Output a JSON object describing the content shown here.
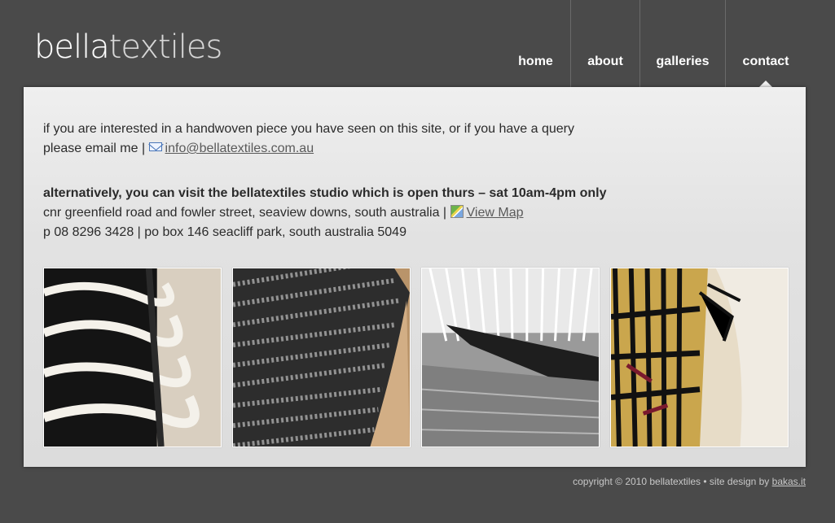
{
  "logo": {
    "part1": "bella",
    "part2": "textiles"
  },
  "nav": {
    "items": [
      {
        "label": "home"
      },
      {
        "label": "about"
      },
      {
        "label": "galleries"
      },
      {
        "label": "contact"
      }
    ],
    "active": "contact"
  },
  "content": {
    "line1": "if you are interested in a handwoven piece you have seen on this site, or if you have a query",
    "line2_prefix": "please email me | ",
    "email": "info@bellatextiles.com.au",
    "visit_heading": "alternatively, you can visit the bellatextiles studio which is open thurs – sat 10am-4pm only",
    "address_prefix": "cnr greenfield road and fowler street, seaview downs, south australia | ",
    "map_link": "View Map",
    "phone_line": "p 08 8296 3428 | po box 146 seacliff park, south australia 5049"
  },
  "photos": [
    {
      "icon": "woven-wool-photo"
    },
    {
      "icon": "herringbone-weave-photo"
    },
    {
      "icon": "loom-threads-photo"
    },
    {
      "icon": "tapestry-detail-photo"
    }
  ],
  "footer": {
    "text": "copyright © 2010 bellatextiles • site design by ",
    "credit": "bakas.it"
  },
  "colors": {
    "background": "#4a4a4a",
    "panel": "#e2e2e2",
    "nav_text": "#ffffff",
    "body_text": "#2b2b2b",
    "link": "#5a5a5a"
  }
}
